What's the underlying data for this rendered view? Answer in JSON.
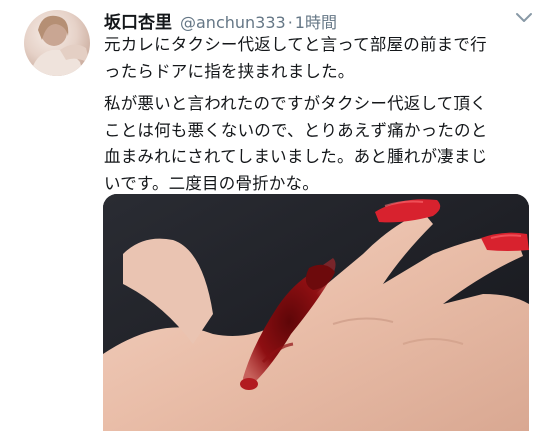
{
  "tweet": {
    "author_name": "坂口杏里",
    "handle": "@anchun333",
    "separator": "·",
    "time": "1時間",
    "text_lines": [
      [
        "元カレにタクシー代返してと言って部屋の前まで行",
        "ったらドアに指を挟まれました。"
      ],
      [
        "私が悪いと言われたのですがタクシー代返して頂く",
        "ことは何も悪くないので、とりあえず痛かったのと",
        "血まみれにされてしまいました。あと腫れが凄まじ",
        "いです。二度目の骨折かな。"
      ]
    ],
    "avatar_icon": "profile-photo",
    "menu_icon": "chevron-down-icon",
    "media_icon": "photo-injured-hand"
  },
  "colors": {
    "name": "#14171a",
    "secondary": "#657786",
    "text": "#14171a",
    "nail": "#d8222e",
    "blood": "#8e0f12"
  }
}
